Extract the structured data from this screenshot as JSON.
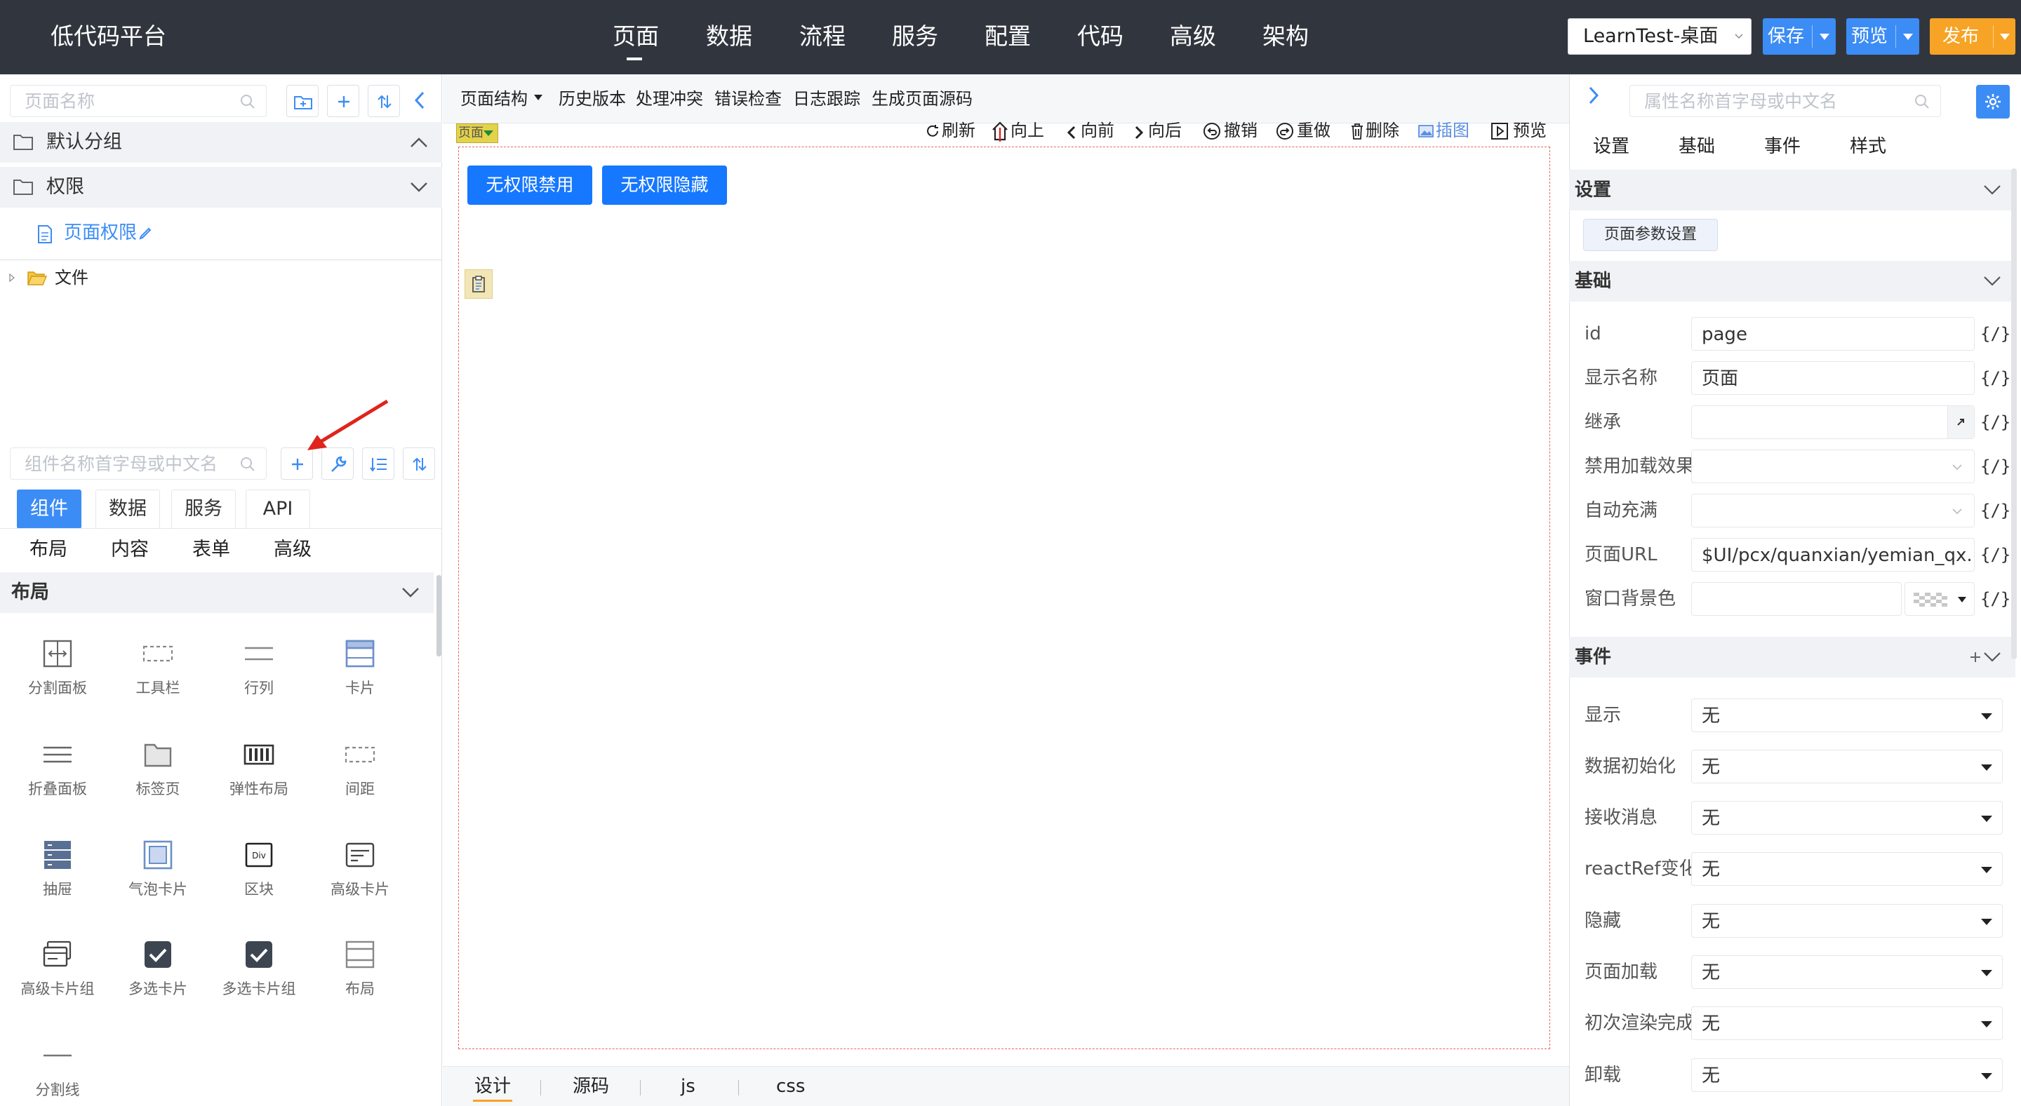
{
  "header": {
    "logo": "低代码平台",
    "nav": [
      "页面",
      "数据",
      "流程",
      "服务",
      "配置",
      "代码",
      "高级",
      "架构"
    ],
    "active_nav": "页面",
    "app_select": "LearnTest-桌面",
    "save_label": "保存",
    "preview_label": "预览",
    "publish_label": "发布",
    "colors": {
      "bg": "#31363e",
      "save": "#3c8cf5",
      "publish": "#f7a325"
    }
  },
  "left": {
    "page_search_placeholder": "页面名称",
    "groups": [
      {
        "label": "默认分组",
        "expanded": true
      },
      {
        "label": "权限",
        "expanded": false
      }
    ],
    "page_item": "页面权限",
    "tree_folder": "文件",
    "comp_search_placeholder": "组件名称首字母或中文名",
    "tabs": [
      "组件",
      "数据",
      "服务",
      "API"
    ],
    "active_tab": "组件",
    "subtabs": [
      "布局",
      "内容",
      "表单",
      "高级"
    ],
    "section_title": "布局",
    "components": [
      {
        "label": "分割面板",
        "icon": "split-panel-icon"
      },
      {
        "label": "工具栏",
        "icon": "toolbar-icon"
      },
      {
        "label": "行列",
        "icon": "row-col-icon"
      },
      {
        "label": "卡片",
        "icon": "card-icon"
      },
      {
        "label": "折叠面板",
        "icon": "collapse-icon"
      },
      {
        "label": "标签页",
        "icon": "tabs-folder-icon"
      },
      {
        "label": "弹性布局",
        "icon": "flex-layout-icon"
      },
      {
        "label": "间距",
        "icon": "spacing-icon"
      },
      {
        "label": "抽屉",
        "icon": "drawer-icon"
      },
      {
        "label": "气泡卡片",
        "icon": "bubble-card-icon"
      },
      {
        "label": "区块",
        "icon": "div-block-icon"
      },
      {
        "label": "高级卡片",
        "icon": "advanced-card-icon"
      },
      {
        "label": "高级卡片组",
        "icon": "card-group-icon"
      },
      {
        "label": "多选卡片",
        "icon": "checkbox-card-icon"
      },
      {
        "label": "多选卡片组",
        "icon": "checkbox-card-group-icon"
      },
      {
        "label": "布局",
        "icon": "layout-icon"
      },
      {
        "label": "分割线",
        "icon": "divider-icon"
      }
    ]
  },
  "center": {
    "toolbar": [
      "页面结构",
      "历史版本",
      "处理冲突",
      "错误检查",
      "日志跟踪",
      "生成页面源码"
    ],
    "canvas_tools": [
      "刷新",
      "向上",
      "向前",
      "向后",
      "撤销",
      "重做",
      "删除",
      "插图",
      "预览"
    ],
    "page_tag": "页面",
    "buttons": [
      "无权限禁用",
      "无权限隐藏"
    ],
    "bottom_tabs": [
      "设计",
      "源码",
      "js",
      "css"
    ],
    "active_bottom_tab": "设计"
  },
  "right": {
    "search_placeholder": "属性名称首字母或中文名",
    "tabs": [
      "设置",
      "基础",
      "事件",
      "样式"
    ],
    "settings_title": "设置",
    "page_params_button": "页面参数设置",
    "basic_title": "基础",
    "basic_props": [
      {
        "label": "id",
        "value": "page"
      },
      {
        "label": "显示名称",
        "value": "页面"
      },
      {
        "label": "继承",
        "value": ""
      },
      {
        "label": "禁用加载效果",
        "value": ""
      },
      {
        "label": "自动充满",
        "value": ""
      },
      {
        "label": "页面URL",
        "value": "$UI/pcx/quanxian/yemian_qx.w"
      },
      {
        "label": "窗口背景色",
        "value": ""
      }
    ],
    "expr_label": "{/}",
    "events_title": "事件",
    "events": [
      {
        "label": "显示",
        "value": "无"
      },
      {
        "label": "数据初始化",
        "value": "无"
      },
      {
        "label": "接收消息",
        "value": "无"
      },
      {
        "label": "reactRef变化",
        "value": "无"
      },
      {
        "label": "隐藏",
        "value": "无"
      },
      {
        "label": "页面加载",
        "value": "无"
      },
      {
        "label": "初次渲染完成",
        "value": "无"
      },
      {
        "label": "卸载",
        "value": "无"
      }
    ]
  }
}
